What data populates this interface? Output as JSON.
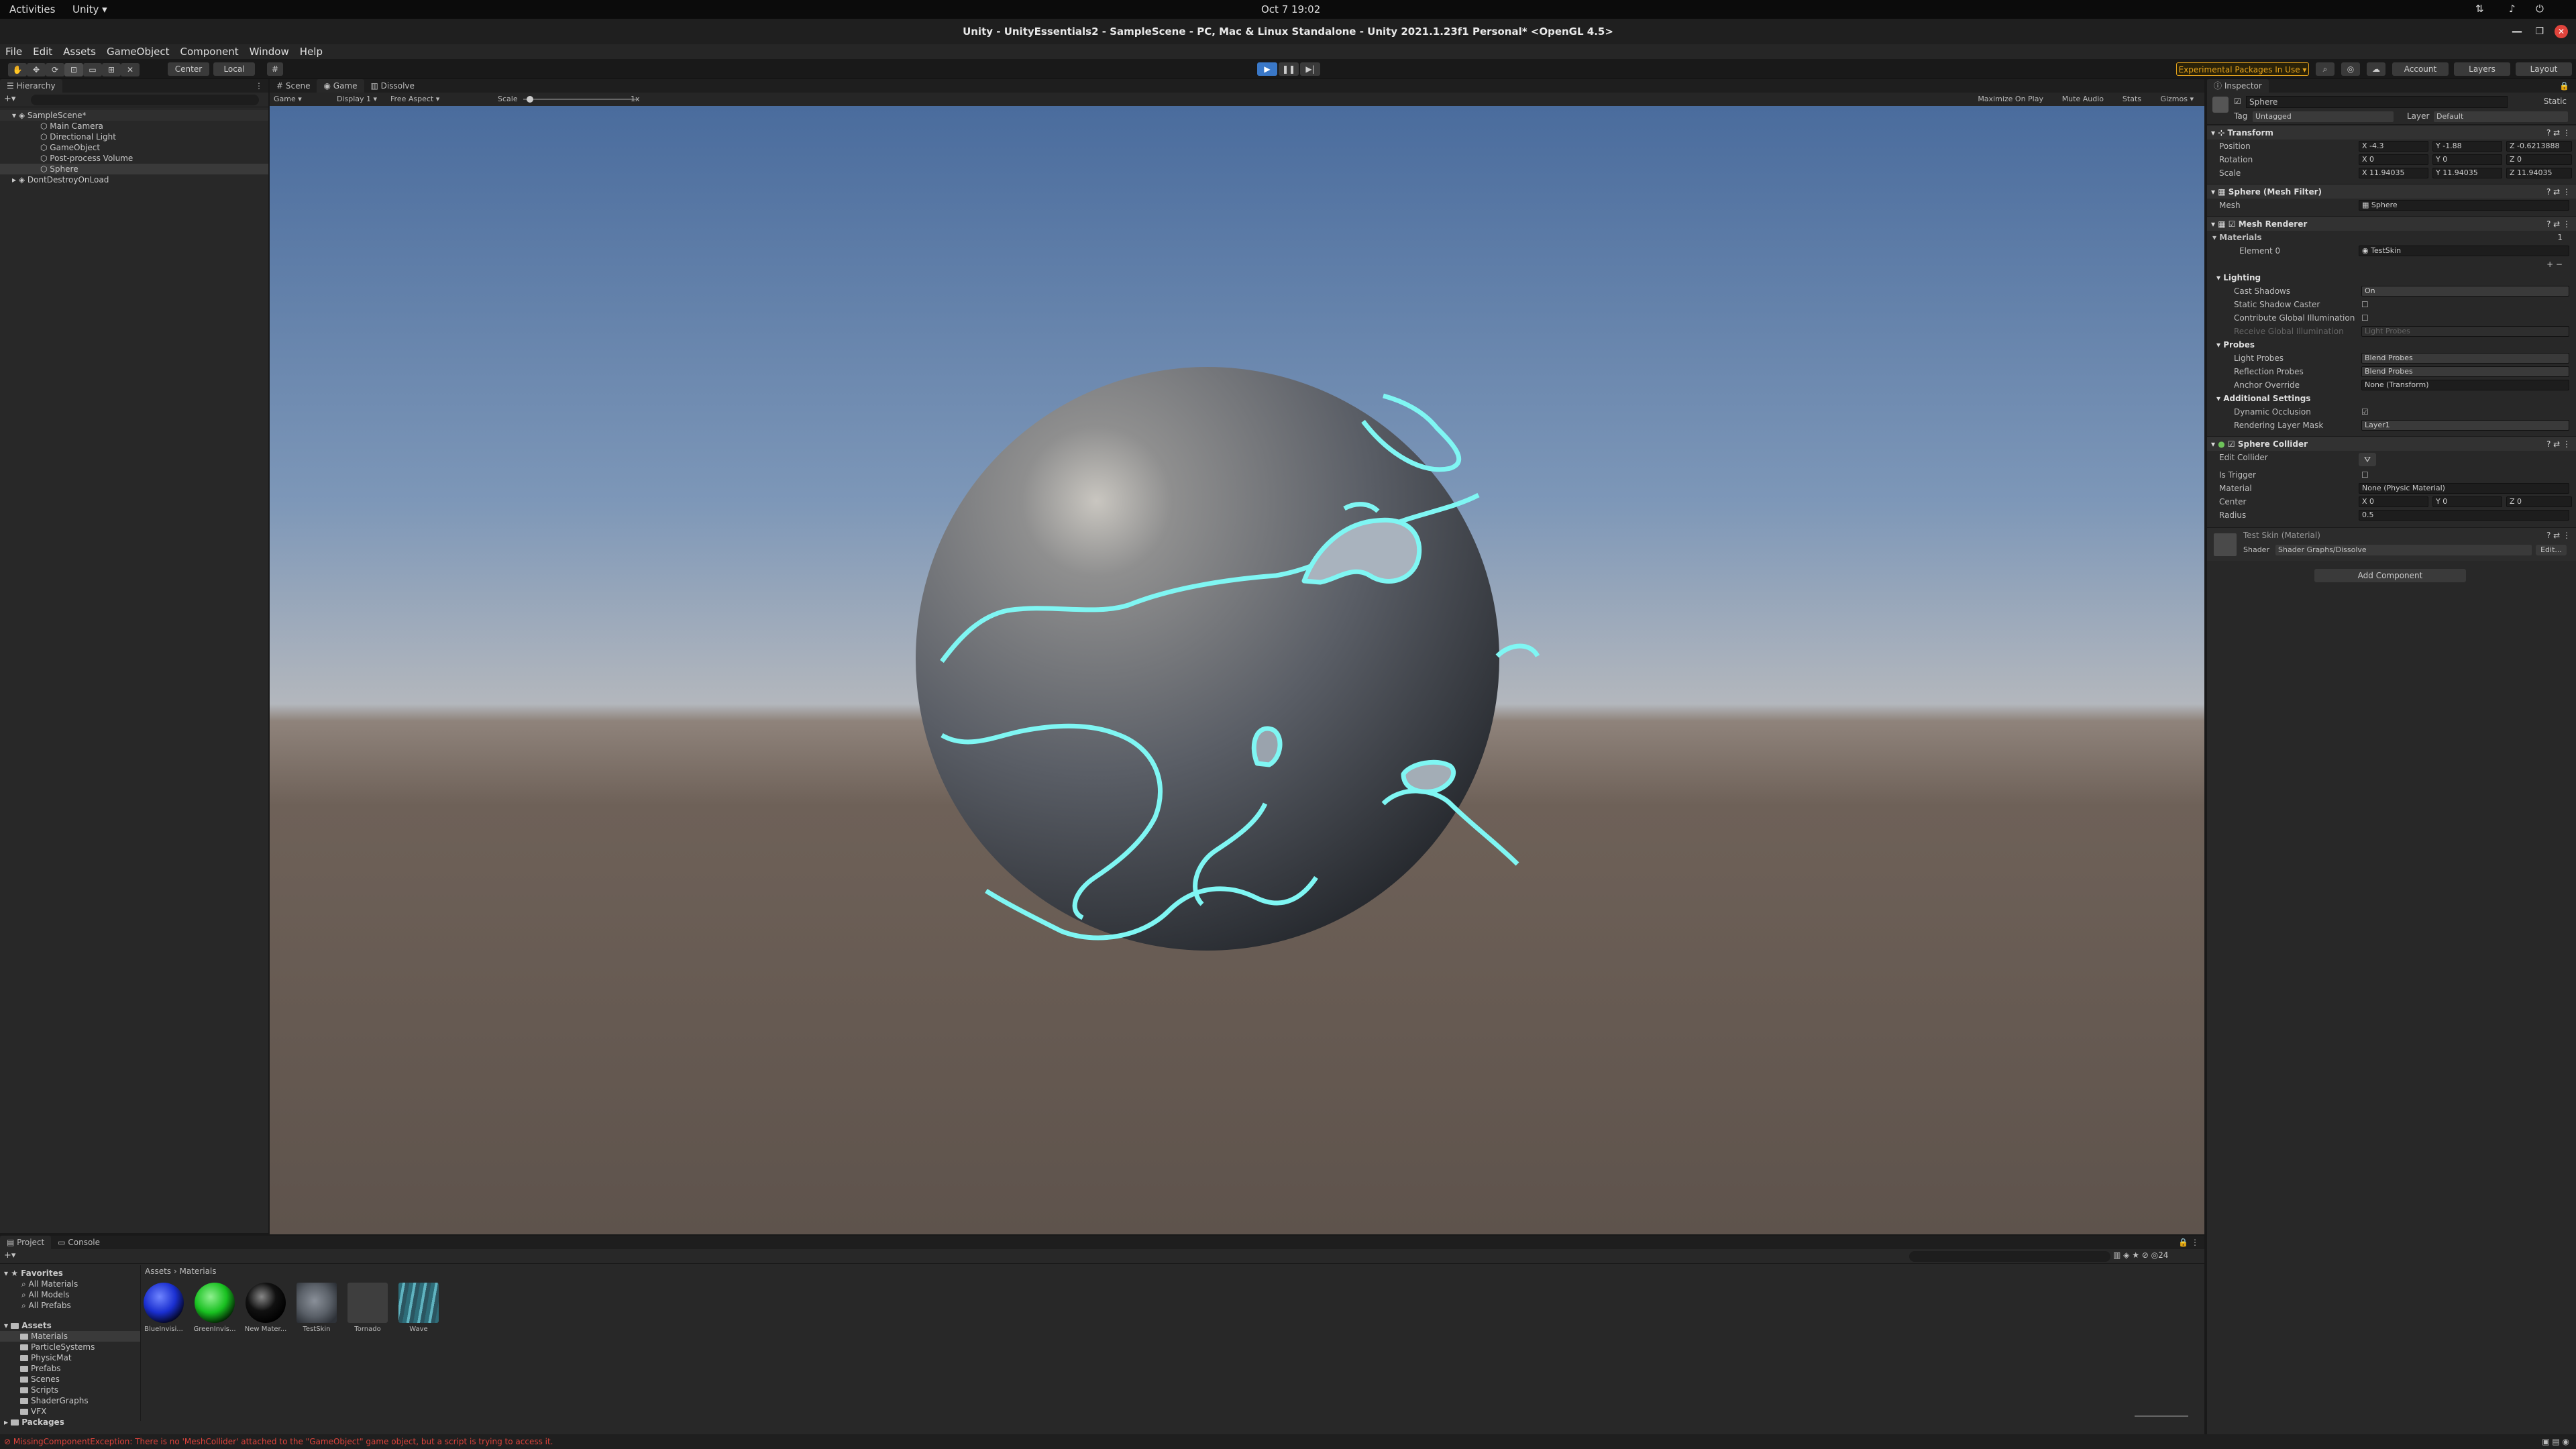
{
  "system": {
    "activities": "Activities",
    "app_menu": "Unity ▾",
    "clock": "Oct 7  19:02"
  },
  "window": {
    "title": "Unity - UnityEssentials2 - SampleScene - PC, Mac & Linux Standalone - Unity 2021.1.23f1 Personal* <OpenGL 4.5>"
  },
  "menu": [
    "File",
    "Edit",
    "Assets",
    "GameObject",
    "Component",
    "Window",
    "Help"
  ],
  "toolbar": {
    "pivot": "Center",
    "space": "Local",
    "packages_warning": "Experimental Packages In Use ▾",
    "account": "Account",
    "layers": "Layers",
    "layout": "Layout"
  },
  "hierarchy": {
    "tab": "Hierarchy",
    "items": [
      {
        "label": "SampleScene*",
        "indent": 0
      },
      {
        "label": "Main Camera",
        "indent": 1
      },
      {
        "label": "Directional Light",
        "indent": 1
      },
      {
        "label": "GameObject",
        "indent": 1
      },
      {
        "label": "Post-process Volume",
        "indent": 1
      },
      {
        "label": "Sphere",
        "indent": 1
      },
      {
        "label": "DontDestroyOnLoad",
        "indent": 0
      }
    ]
  },
  "view_tabs": [
    "Scene",
    "Game",
    "Dissolve"
  ],
  "game_bar": {
    "mode": "Game",
    "display": "Display 1",
    "aspect": "Free Aspect",
    "scale_label": "Scale",
    "scale_value": "1x",
    "right": [
      "Maximize On Play",
      "Mute Audio",
      "Stats",
      "Gizmos"
    ]
  },
  "inspector": {
    "tab": "Inspector",
    "object_name": "Sphere",
    "static": "Static",
    "tag_label": "Tag",
    "tag": "Untagged",
    "layer_label": "Layer",
    "layer": "Default",
    "transform": {
      "title": "Transform",
      "position": {
        "label": "Position",
        "x": "-4.3",
        "y": "-1.88",
        "z": "-0.6213888"
      },
      "rotation": {
        "label": "Rotation",
        "x": "0",
        "y": "0",
        "z": "0"
      },
      "scale": {
        "label": "Scale",
        "x": "11.94035",
        "y": "11.94035",
        "z": "11.94035"
      }
    },
    "mesh_filter": {
      "title": "Sphere (Mesh Filter)",
      "mesh_label": "Mesh",
      "mesh": "Sphere"
    },
    "mesh_renderer": {
      "title": "Mesh Renderer",
      "materials_label": "Materials",
      "materials_count": "1",
      "element0_label": "Element 0",
      "element0": "TestSkin",
      "lighting": "Lighting",
      "cast_shadows_label": "Cast Shadows",
      "cast_shadows": "On",
      "static_shadow_caster": "Static Shadow Caster",
      "contribute_gi": "Contribute Global Illumination",
      "receive_gi_label": "Receive Global Illumination",
      "receive_gi": "Light Probes",
      "probes": "Probes",
      "light_probes_label": "Light Probes",
      "light_probes": "Blend Probes",
      "reflection_probes_label": "Reflection Probes",
      "reflection_probes": "Blend Probes",
      "anchor_override_label": "Anchor Override",
      "anchor_override": "None (Transform)",
      "additional": "Additional Settings",
      "dynamic_occlusion": "Dynamic Occlusion",
      "rendering_layer_label": "Rendering Layer Mask",
      "rendering_layer": "Layer1"
    },
    "sphere_collider": {
      "title": "Sphere Collider",
      "edit_collider": "Edit Collider",
      "is_trigger": "Is Trigger",
      "material_label": "Material",
      "material": "None (Physic Material)",
      "center_label": "Center",
      "center": {
        "x": "0",
        "y": "0",
        "z": "0"
      },
      "radius_label": "Radius",
      "radius": "0.5"
    },
    "material": {
      "title": "Test Skin (Material)",
      "shader_label": "Shader",
      "shader": "Shader Graphs/Dissolve",
      "edit": "Edit..."
    },
    "add_component": "Add Component"
  },
  "project": {
    "tabs": [
      "Project",
      "Console"
    ],
    "favorites_label": "Favorites",
    "favorites": [
      "All Materials",
      "All Models",
      "All Prefabs"
    ],
    "assets_label": "Assets",
    "folders": [
      "Materials",
      "ParticleSystems",
      "PhysicMat",
      "Prefabs",
      "Scenes",
      "Scripts",
      "ShaderGraphs",
      "VFX"
    ],
    "packages_label": "Packages",
    "breadcrumb_root": "Assets",
    "breadcrumb_leaf": "Materials",
    "assets": [
      {
        "label": "BlueInvisi...",
        "color": "#1a2fd0"
      },
      {
        "label": "GreenInvis...",
        "color": "#18c020"
      },
      {
        "label": "New Mater...",
        "color": "#050505"
      },
      {
        "label": "TestSkin",
        "color": "#5a6068"
      },
      {
        "label": "Tornado",
        "color": "#3e3e3e"
      },
      {
        "label": "Wave",
        "color": "#3a7d8a"
      }
    ]
  },
  "status": {
    "error": "MissingComponentException: There is no 'MeshCollider' attached to the \"GameObject\" game object, but a script is trying to access it."
  },
  "colors": {
    "accent": "#3a78c8",
    "dissolve_edge": "#7ff6f3",
    "warning": "#e8a41c",
    "error": "#e0443c"
  }
}
